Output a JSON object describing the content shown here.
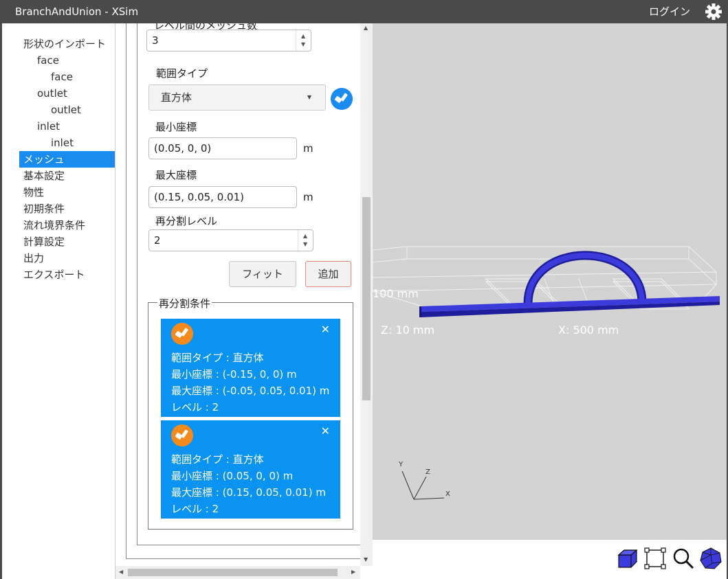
{
  "window": {
    "title": "BranchAndUnion - XSim",
    "login_label": "ログイン"
  },
  "sidebar": {
    "items": [
      {
        "label": "形状のインポート",
        "level": 0
      },
      {
        "label": "face",
        "level": 1
      },
      {
        "label": "face",
        "level": 2
      },
      {
        "label": "outlet",
        "level": 1
      },
      {
        "label": "outlet",
        "level": 2
      },
      {
        "label": "inlet",
        "level": 1
      },
      {
        "label": "inlet",
        "level": 2
      },
      {
        "label": "メッシュ",
        "level": 0,
        "active": true
      },
      {
        "label": "基本設定",
        "level": 0
      },
      {
        "label": "物性",
        "level": 0
      },
      {
        "label": "初期条件",
        "level": 0
      },
      {
        "label": "流れ境界条件",
        "level": 0
      },
      {
        "label": "計算設定",
        "level": 0
      },
      {
        "label": "出力",
        "level": 0
      },
      {
        "label": "エクスポート",
        "level": 0
      }
    ]
  },
  "form": {
    "cut_label": "レベル間のメッシュ数",
    "mesh_count_value": "3",
    "range_type_label": "範囲タイプ",
    "range_type_value": "直方体",
    "min_coord_label": "最小座標",
    "min_coord_value": "(0.05, 0, 0)",
    "max_coord_label": "最大座標",
    "max_coord_value": "(0.15, 0.05, 0.01)",
    "unit": "m",
    "refine_level_label": "再分割レベル",
    "refine_level_value": "2",
    "fit_button": "フィット",
    "add_button": "追加",
    "conditions_legend": "再分割条件"
  },
  "conditions": [
    {
      "type": "範囲タイプ : 直方体",
      "min": "最小座標 : (-0.15, 0, 0) m",
      "max": "最大座標 : (-0.05, 0.05, 0.01) m",
      "level": "レベル : 2"
    },
    {
      "type": "範囲タイプ : 直方体",
      "min": "最小座標 : (0.05, 0, 0) m",
      "max": "最大座標 : (0.15, 0.05, 0.01) m",
      "level": "レベル : 2"
    }
  ],
  "viewport": {
    "label_y": "100 mm",
    "label_z": "Z: 10 mm",
    "label_x": "X: 500 mm",
    "axis_x": "X",
    "axis_y": "Y",
    "axis_z": "Z",
    "geometry_color": "#3b3bdc"
  },
  "colors": {
    "accent": "#1a8cf0",
    "card": "#0a93f0",
    "badge": "#f28a1e",
    "titlebar": "#4a4a4a"
  },
  "toolbar": {
    "icons": [
      "cube-icon",
      "fit-frame-icon",
      "zoom-icon",
      "polyhedron-icon"
    ]
  }
}
